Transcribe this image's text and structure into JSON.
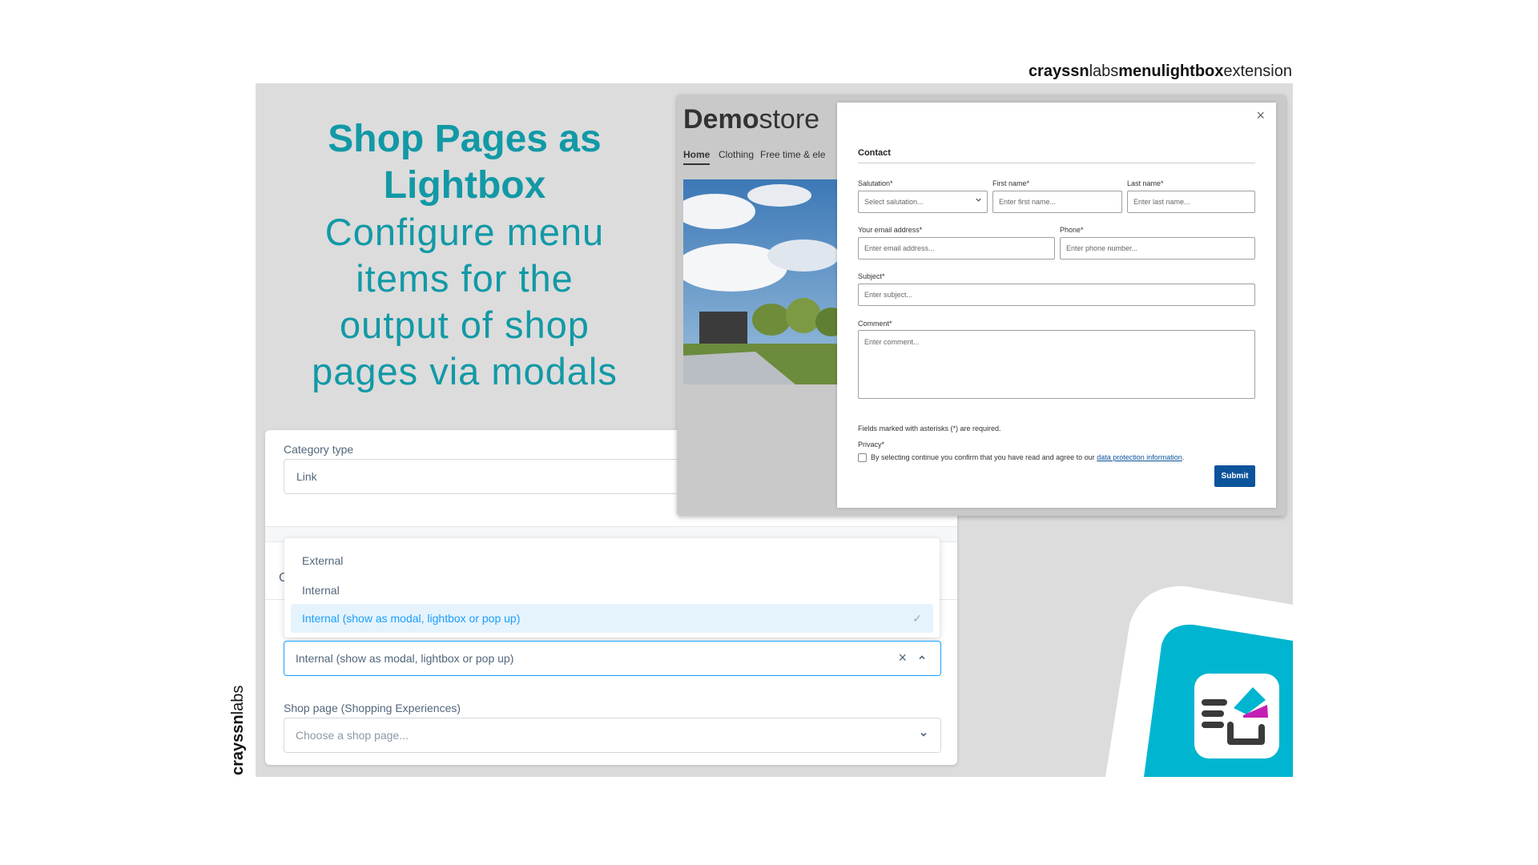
{
  "brand": {
    "top_bold_1": "crayssn",
    "top_thin_1": "labs",
    "top_bold_2": "menulightbox",
    "top_thin_2": "extension",
    "side_bold": "crayssn",
    "side_thin": "labs"
  },
  "headline": {
    "line1": "Shop Pages as",
    "line2": "Lightbox",
    "sub1": "Configure menu",
    "sub2": "items for the",
    "sub3": "output of shop",
    "sub4": "pages via modals"
  },
  "admin": {
    "category_type_label": "Category type",
    "category_type_value": "Link",
    "partial_letter": "C",
    "dropdown_options": [
      "External",
      "Internal",
      "Internal (show as modal, lightbox or pop up)"
    ],
    "selected_value": "Internal (show as modal, lightbox or pop up)",
    "shop_page_label": "Shop page (Shopping Experiences)",
    "shop_page_placeholder": "Choose a shop page..."
  },
  "store": {
    "logo_bold": "Demo",
    "logo_light": "store",
    "nav": [
      "Home",
      "Clothing",
      "Free time & ele"
    ]
  },
  "modal": {
    "close": "×",
    "title": "Contact",
    "salutation_label": "Salutation*",
    "salutation_value": "Select salutation...",
    "first_name_label": "First name*",
    "first_name_placeholder": "Enter first name...",
    "last_name_label": "Last name*",
    "last_name_placeholder": "Enter last name...",
    "email_label": "Your email address*",
    "email_placeholder": "Enter email address...",
    "phone_label": "Phone*",
    "phone_placeholder": "Enter phone number...",
    "subject_label": "Subject*",
    "subject_placeholder": "Enter subject...",
    "comment_label": "Comment*",
    "comment_placeholder": "Enter comment...",
    "required_note": "Fields marked with asterisks (*) are required.",
    "privacy_label": "Privacy*",
    "consent_text": "By selecting continue you confirm that you have read and agree to our",
    "consent_link": "data protection information",
    "consent_end": ".",
    "submit": "Submit"
  },
  "colors": {
    "teal": "#1299a6",
    "modal_button": "#0b539b",
    "selection_blue": "#189eff",
    "corner_cyan": "#00b5cf",
    "corner_magenta": "#c41fb4"
  }
}
